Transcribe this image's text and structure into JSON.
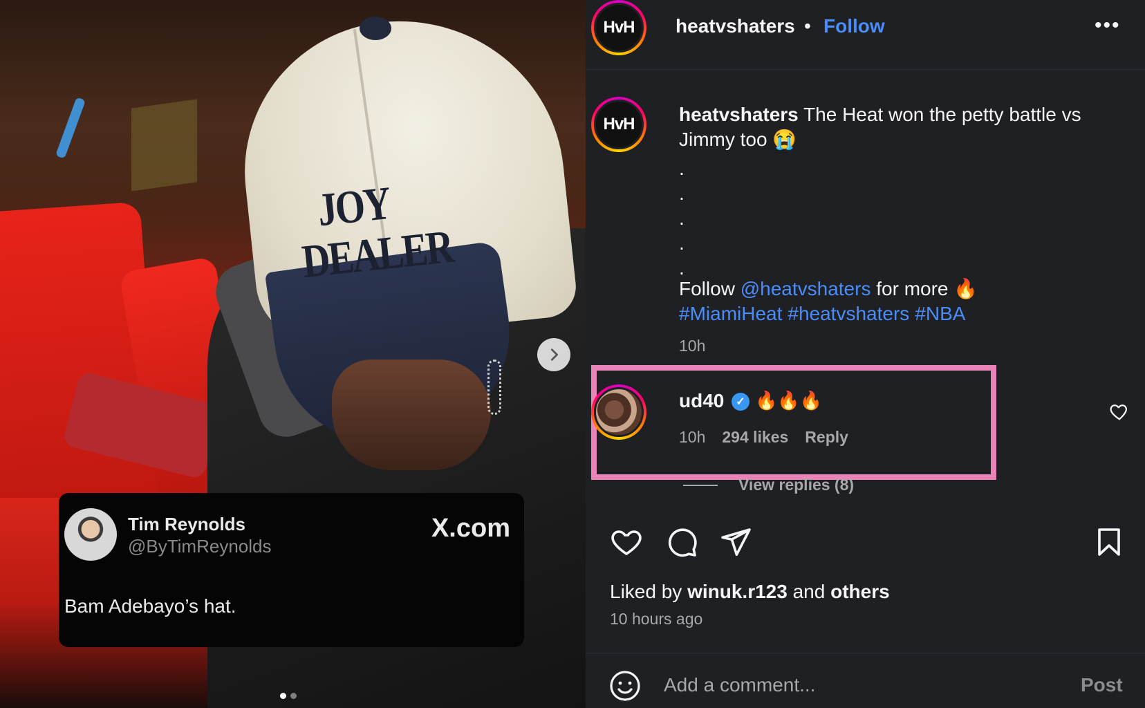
{
  "tweet": {
    "name": "Tim Reynolds",
    "handle": "@ByTimReynolds",
    "source": "X.com",
    "text": "Bam Adebayo’s hat."
  },
  "cap_text": [
    "JOY",
    "DEALER"
  ],
  "carousel": {
    "count": 2,
    "active": 0
  },
  "header": {
    "avatar_text": "HvH",
    "username": "heatvshaters",
    "separator": "•",
    "follow": "Follow"
  },
  "caption": {
    "username": "heatvshaters",
    "text": " The Heat won the petty battle vs Jimmy too 😭",
    "dots": [
      ".",
      ".",
      ".",
      ".",
      "."
    ],
    "follow_prefix": "Follow ",
    "follow_mention": "@heatvshaters",
    "follow_suffix": " for more 🔥",
    "hashtags": [
      "#MiamiHeat",
      "#heatvshaters",
      "#NBA"
    ],
    "time": "10h"
  },
  "comment": {
    "username": "ud40",
    "text": "🔥🔥🔥",
    "time": "10h",
    "likes": "294 likes",
    "reply": "Reply",
    "view_replies": "View replies (8)"
  },
  "likes": {
    "prefix": "Liked by ",
    "user": "winuk.r123",
    "middle": " and ",
    "others": "others",
    "ago": "10 hours ago"
  },
  "composer": {
    "placeholder": "Add a comment...",
    "post": "Post"
  },
  "colors": {
    "link": "#4a8df8",
    "highlight": "#e983b8",
    "panel_bg": "#1f2024"
  }
}
